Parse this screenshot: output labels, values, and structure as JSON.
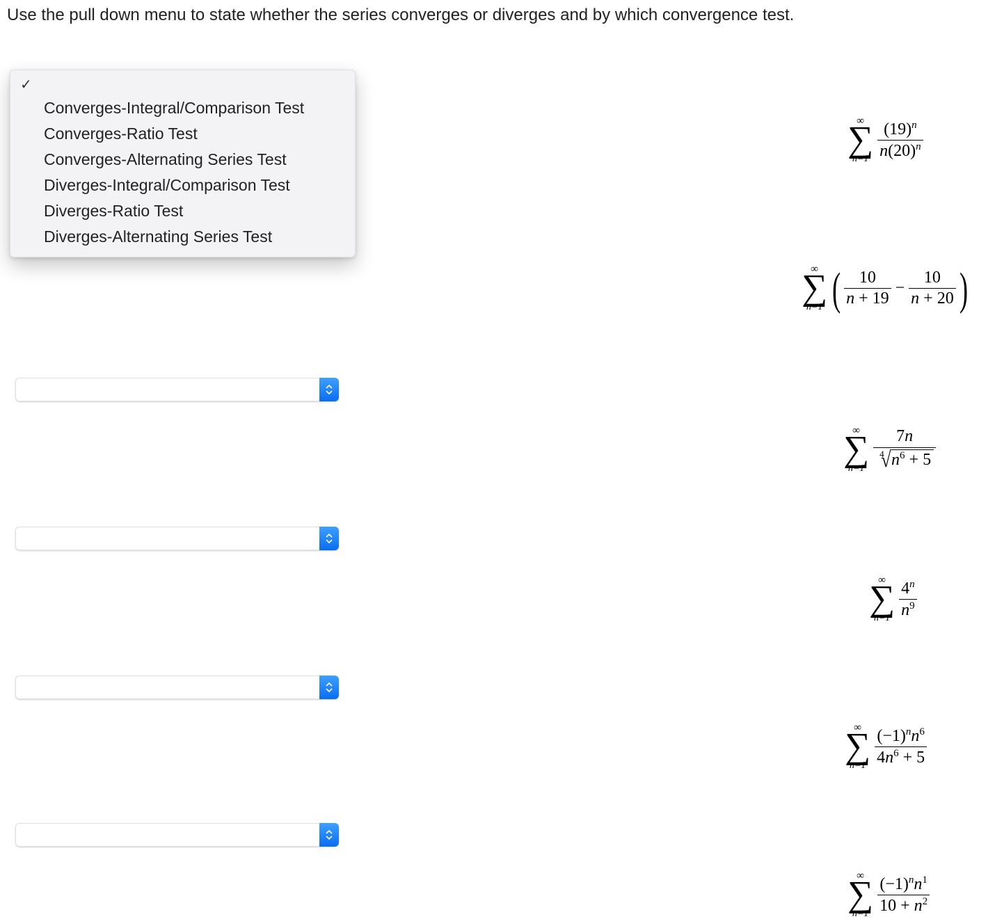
{
  "instruction": "Use the pull down menu to state whether the series converges or diverges and by which convergence test.",
  "menu": {
    "check": "✓",
    "options": [
      "Converges-Integral/Comparison Test",
      "Converges-Ratio Test",
      "Converges-Alternating Series Test",
      "Diverges-Integral/Comparison Test",
      "Diverges-Ratio Test",
      "Diverges-Alternating Series Test"
    ]
  },
  "selects": [
    {
      "value": ""
    },
    {
      "value": ""
    },
    {
      "value": ""
    },
    {
      "value": ""
    }
  ],
  "sum_label": {
    "inf": "∞",
    "sigma": "∑",
    "low": "n=1"
  },
  "formulas": {
    "f1": {
      "num": "(19)",
      "num_sup": "n",
      "den_a": "n",
      "den_b": "(20)",
      "den_sup": "n"
    },
    "f2": {
      "a_num": "10",
      "a_den_l": "n",
      "a_den_plus": " + 19",
      "b_num": "10",
      "b_den_l": "n",
      "b_den_plus": " + 20"
    },
    "f3": {
      "num_c": "7",
      "num_v": "n",
      "root_idx": "4",
      "rad_l": "n",
      "rad_sup": "6",
      "rad_plus": " + 5"
    },
    "f4": {
      "num_b": "4",
      "num_sup": "n",
      "den_v": "n",
      "den_sup": "9"
    },
    "f5": {
      "num_a": "(−1)",
      "num_a_sup": "n",
      "num_v": "n",
      "num_v_sup": "6",
      "den_c": "4",
      "den_v": "n",
      "den_sup": "6",
      "den_plus": " + 5"
    },
    "f6": {
      "num_a": "(−1)",
      "num_a_sup": "n",
      "num_v": "n",
      "num_v_sup": "1",
      "den_c": "10 + ",
      "den_v": "n",
      "den_sup": "2"
    }
  }
}
